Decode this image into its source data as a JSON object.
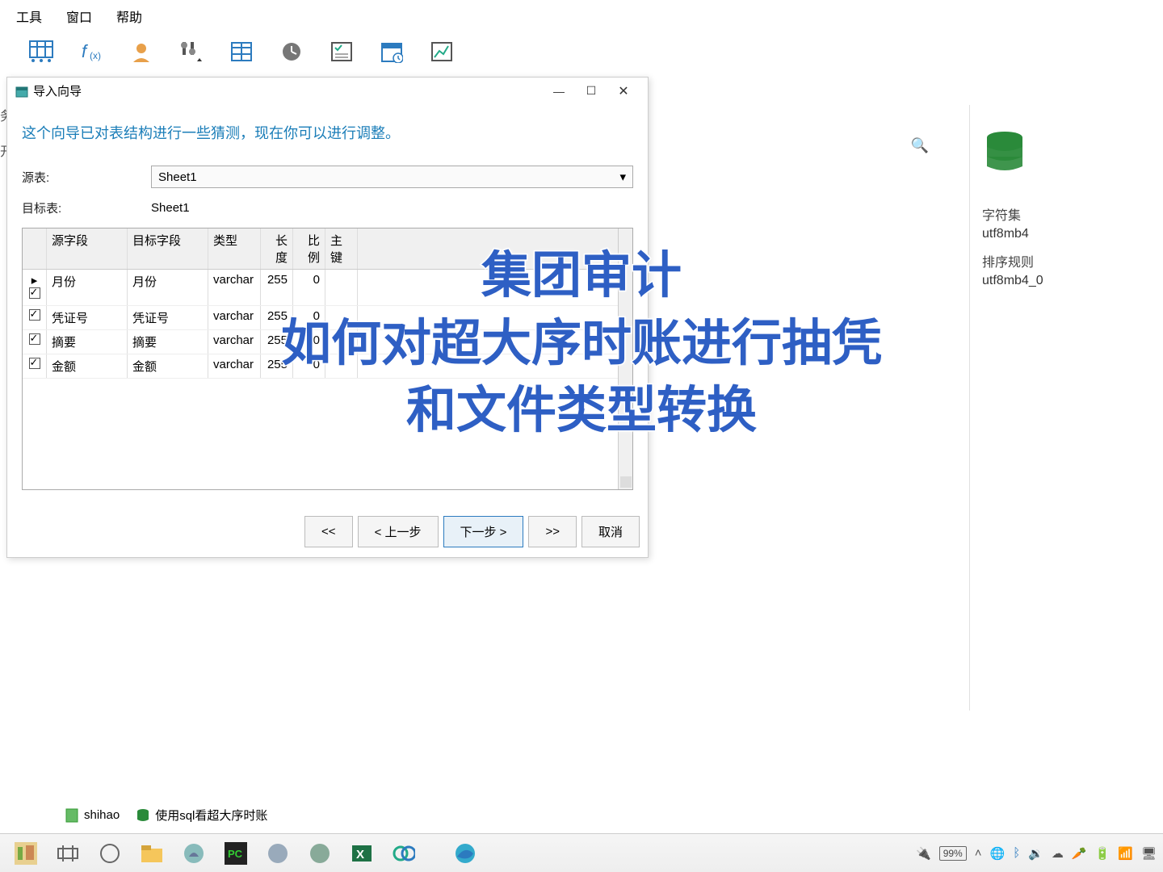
{
  "menu": {
    "tools": "工具",
    "window": "窗口",
    "help": "帮助"
  },
  "left_frag": {
    "a": "务",
    "b": "开"
  },
  "dialog": {
    "title": "导入向导",
    "subtitle": "这个向导已对表结构进行一些猜测，现在你可以进行调整。",
    "src_label": "源表:",
    "src_value": "Sheet1",
    "tgt_label": "目标表:",
    "tgt_value": "Sheet1",
    "grid_headers": {
      "src": "源字段",
      "tgt": "目标字段",
      "type": "类型",
      "len": "长度",
      "scale": "比例",
      "pk": "主键"
    },
    "rows": [
      {
        "src": "月份",
        "tgt": "月份",
        "type": "varchar",
        "len": "255",
        "scale": "0"
      },
      {
        "src": "凭证号",
        "tgt": "凭证号",
        "type": "varchar",
        "len": "255",
        "scale": "0"
      },
      {
        "src": "摘要",
        "tgt": "摘要",
        "type": "varchar",
        "len": "255",
        "scale": "0"
      },
      {
        "src": "金额",
        "tgt": "金额",
        "type": "varchar",
        "len": "255",
        "scale": "0"
      }
    ],
    "buttons": {
      "first": "<<",
      "prev": "<  上一步",
      "next": "下一步  >",
      "last": ">>",
      "cancel": "取消"
    }
  },
  "overlay": {
    "l1": "集团审计",
    "l2": "如何对超大序时账进行抽凭",
    "l3": "和文件类型转换"
  },
  "rightpanel": {
    "charset_label": "字符集",
    "charset_value": "utf8mb4",
    "collation_label": "排序规则",
    "collation_value": "utf8mb4_0"
  },
  "docs": {
    "a": "shihao",
    "b": "使用sql看超大序时账"
  },
  "tray": {
    "battery": "99%"
  }
}
